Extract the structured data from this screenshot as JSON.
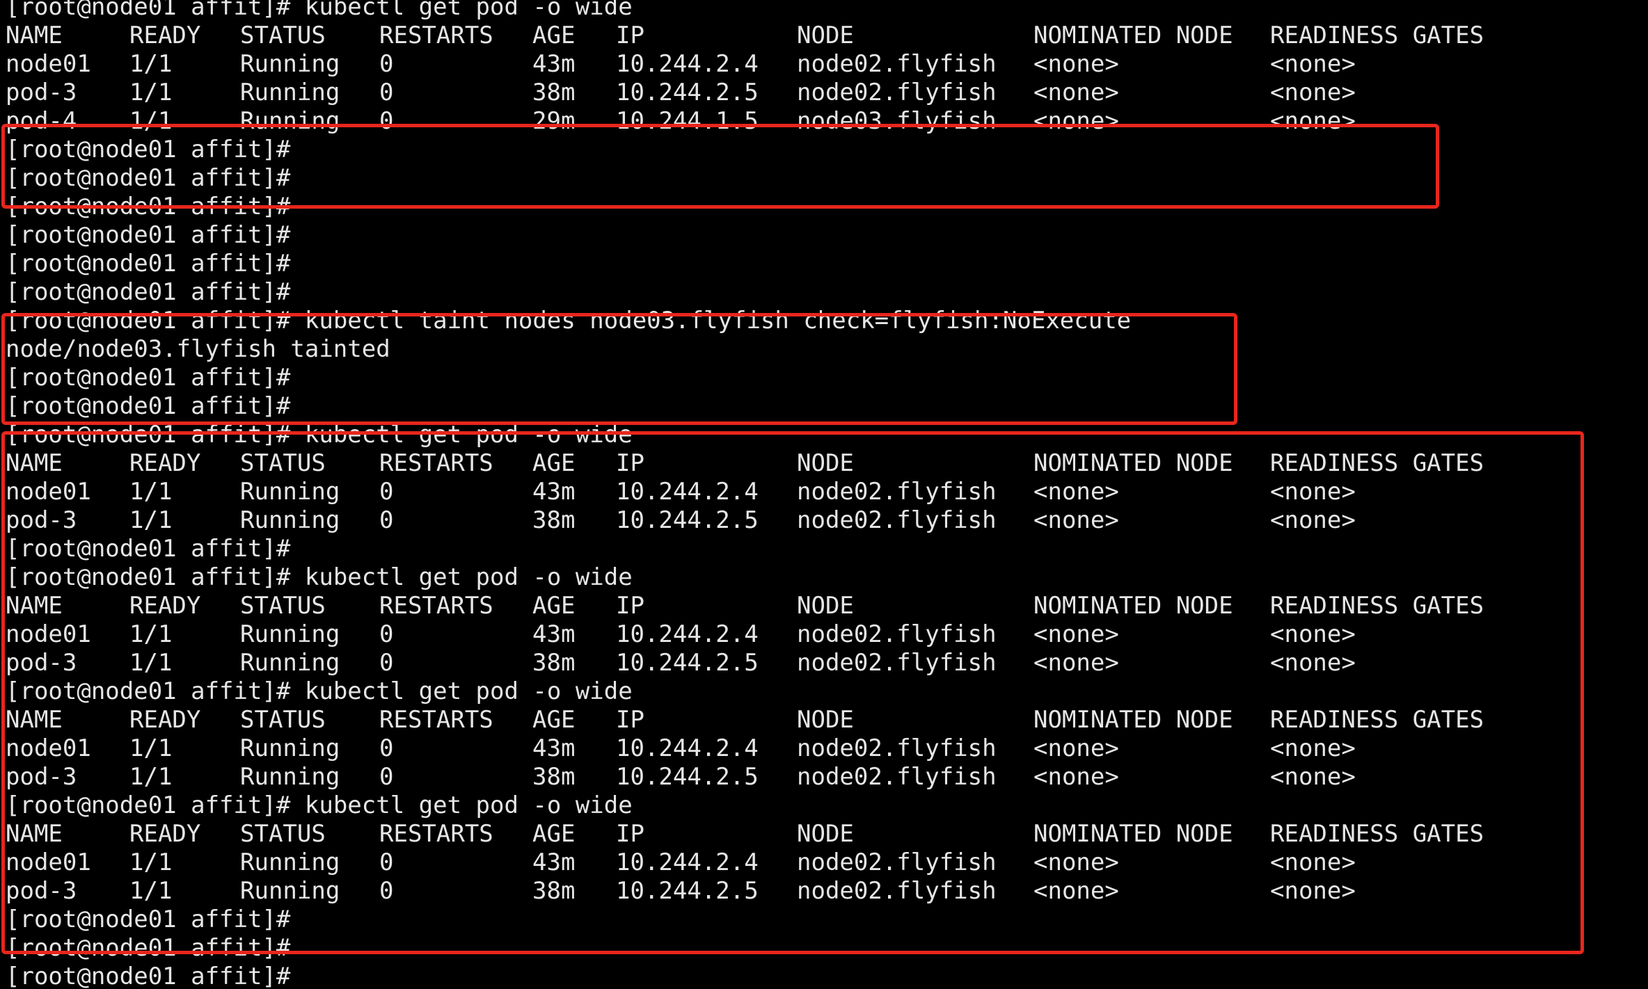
{
  "terminal": {
    "prompt": "[root@node01 affit]#",
    "cmd_get_pod": "kubectl get pod -o wide",
    "cmd_taint": "kubectl taint nodes node03.flyfish check=flyfish:NoExecute",
    "taint_result": "node/node03.flyfish tainted",
    "headers": [
      "NAME",
      "READY",
      "STATUS",
      "RESTARTS",
      "AGE",
      "IP",
      "NODE",
      "NOMINATED NODE",
      "READINESS GATES"
    ],
    "rows": {
      "node01": [
        "node01",
        "1/1",
        "Running",
        "0",
        "43m",
        "10.244.2.4",
        "node02.flyfish",
        "<none>",
        "<none>"
      ],
      "pod3": [
        "pod-3",
        "1/1",
        "Running",
        "0",
        "38m",
        "10.244.2.5",
        "node02.flyfish",
        "<none>",
        "<none>"
      ],
      "pod4": [
        "pod-4",
        "1/1",
        "Running",
        "0",
        "29m",
        "10.244.1.5",
        "node03.flyfish",
        "<none>",
        "<none>"
      ]
    }
  },
  "colors": {
    "background": "#000000",
    "text": "#e6e6e6",
    "highlight": "#e8261d"
  }
}
